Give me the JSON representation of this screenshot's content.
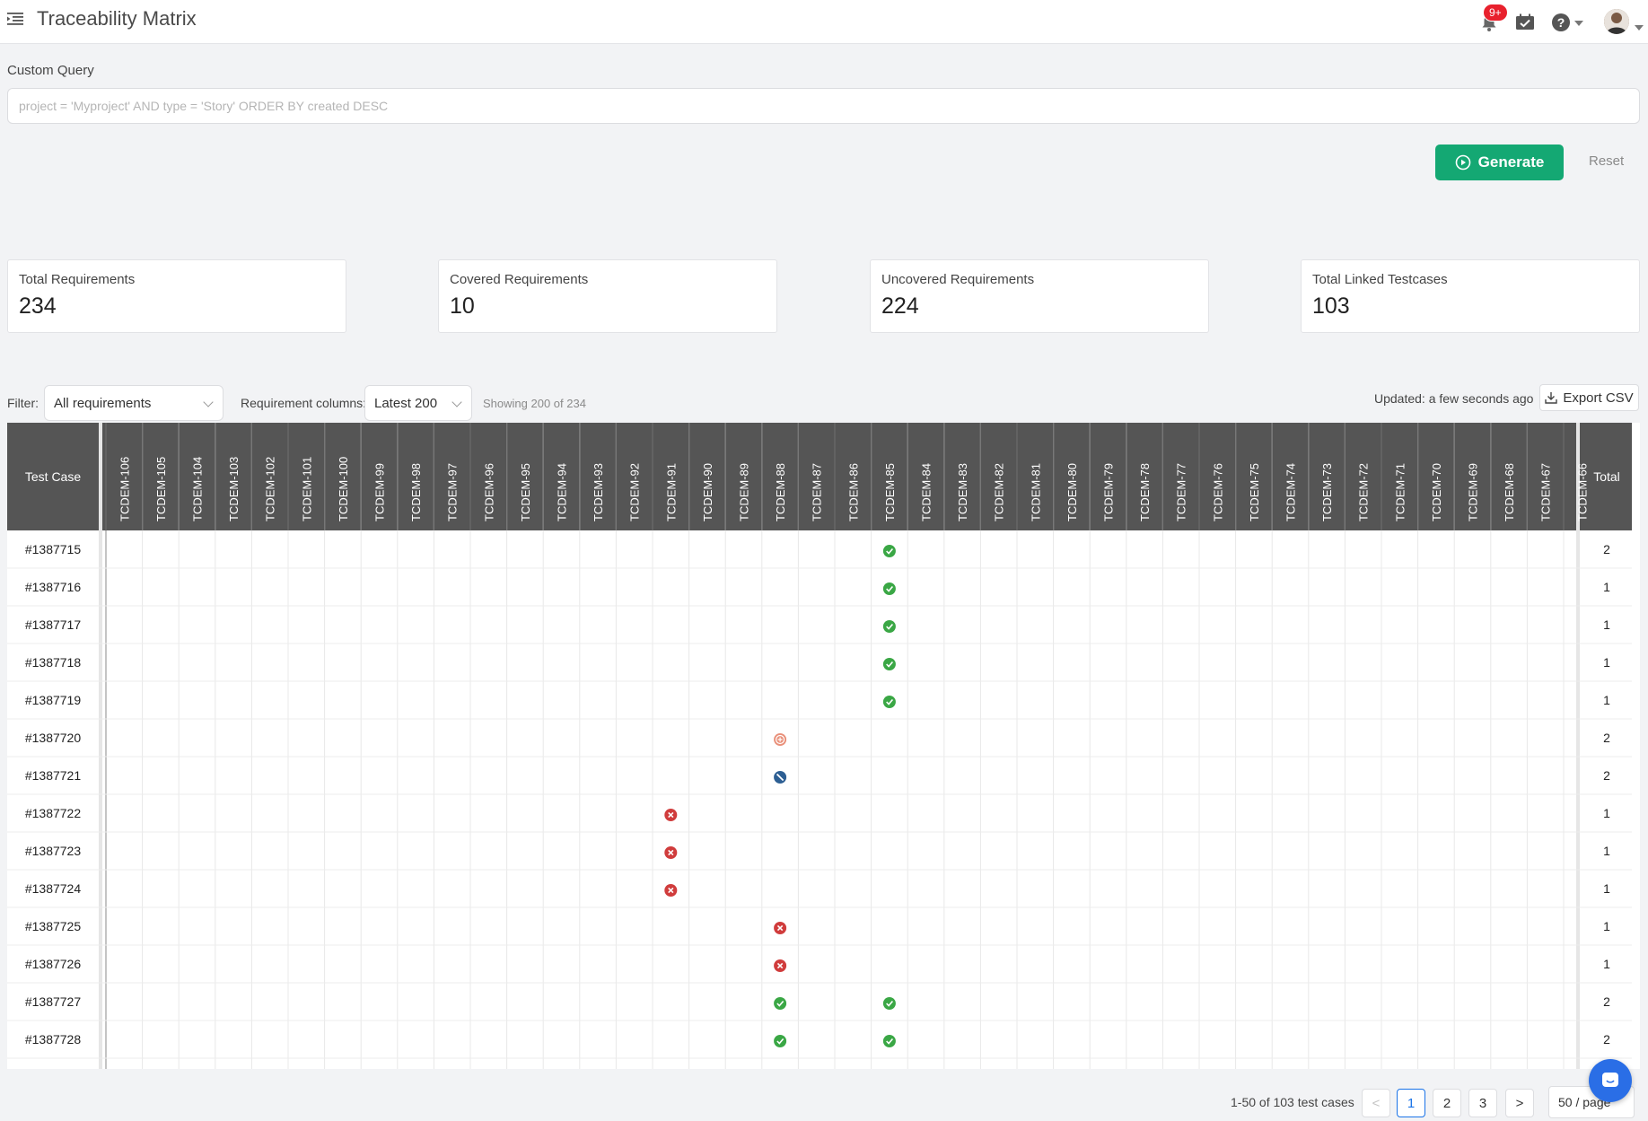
{
  "header": {
    "title": "Traceability Matrix",
    "notification_badge": "9+",
    "icons": [
      "menu-icon",
      "bell-icon",
      "calendar-check-icon",
      "help-icon",
      "avatar"
    ]
  },
  "query": {
    "label": "Custom Query",
    "placeholder": "project = 'Myproject' AND type = 'Story' ORDER BY created DESC",
    "value": ""
  },
  "actions": {
    "generate_label": "Generate",
    "reset_label": "Reset"
  },
  "stats": [
    {
      "label": "Total Requirements",
      "value": "234"
    },
    {
      "label": "Covered Requirements",
      "value": "10"
    },
    {
      "label": "Uncovered Requirements",
      "value": "224"
    },
    {
      "label": "Total Linked Testcases",
      "value": "103"
    }
  ],
  "filters": {
    "filter_label": "Filter:",
    "filter_value": "All requirements",
    "columns_label": "Requirement columns:",
    "columns_value": "Latest 200",
    "showing": "Showing 200 of 234",
    "updated": "Updated: a few seconds ago",
    "export_label": "Export CSV"
  },
  "matrix": {
    "row_header": "Test Case",
    "total_header": "Total",
    "columns": [
      "TCDEM-106",
      "TCDEM-105",
      "TCDEM-104",
      "TCDEM-103",
      "TCDEM-102",
      "TCDEM-101",
      "TCDEM-100",
      "TCDEM-99",
      "TCDEM-98",
      "TCDEM-97",
      "TCDEM-96",
      "TCDEM-95",
      "TCDEM-94",
      "TCDEM-93",
      "TCDEM-92",
      "TCDEM-91",
      "TCDEM-90",
      "TCDEM-89",
      "TCDEM-88",
      "TCDEM-87",
      "TCDEM-86",
      "TCDEM-85",
      "TCDEM-84",
      "TCDEM-83",
      "TCDEM-82",
      "TCDEM-81",
      "TCDEM-80",
      "TCDEM-79",
      "TCDEM-78",
      "TCDEM-77",
      "TCDEM-76",
      "TCDEM-75",
      "TCDEM-74",
      "TCDEM-73",
      "TCDEM-72",
      "TCDEM-71",
      "TCDEM-70",
      "TCDEM-69",
      "TCDEM-68",
      "TCDEM-67",
      "TCDEM-66"
    ],
    "status_colors": {
      "pass": "#3aa745",
      "fail": "#d03c3c",
      "blocked": "#2d5f93",
      "in-progress": "#e9907a"
    },
    "rows": [
      {
        "id": "#1387715",
        "total": "2",
        "marks": [
          {
            "col": "TCDEM-85",
            "status": "pass"
          }
        ]
      },
      {
        "id": "#1387716",
        "total": "1",
        "marks": [
          {
            "col": "TCDEM-85",
            "status": "pass"
          }
        ]
      },
      {
        "id": "#1387717",
        "total": "1",
        "marks": [
          {
            "col": "TCDEM-85",
            "status": "pass"
          }
        ]
      },
      {
        "id": "#1387718",
        "total": "1",
        "marks": [
          {
            "col": "TCDEM-85",
            "status": "pass"
          }
        ]
      },
      {
        "id": "#1387719",
        "total": "1",
        "marks": [
          {
            "col": "TCDEM-85",
            "status": "pass"
          }
        ]
      },
      {
        "id": "#1387720",
        "total": "2",
        "marks": [
          {
            "col": "TCDEM-88",
            "status": "in-progress"
          }
        ]
      },
      {
        "id": "#1387721",
        "total": "2",
        "marks": [
          {
            "col": "TCDEM-88",
            "status": "blocked"
          }
        ]
      },
      {
        "id": "#1387722",
        "total": "1",
        "marks": [
          {
            "col": "TCDEM-91",
            "status": "fail"
          }
        ]
      },
      {
        "id": "#1387723",
        "total": "1",
        "marks": [
          {
            "col": "TCDEM-91",
            "status": "fail"
          }
        ]
      },
      {
        "id": "#1387724",
        "total": "1",
        "marks": [
          {
            "col": "TCDEM-91",
            "status": "fail"
          }
        ]
      },
      {
        "id": "#1387725",
        "total": "1",
        "marks": [
          {
            "col": "TCDEM-88",
            "status": "fail"
          }
        ]
      },
      {
        "id": "#1387726",
        "total": "1",
        "marks": [
          {
            "col": "TCDEM-88",
            "status": "fail"
          }
        ]
      },
      {
        "id": "#1387727",
        "total": "2",
        "marks": [
          {
            "col": "TCDEM-88",
            "status": "pass"
          },
          {
            "col": "TCDEM-85",
            "status": "pass"
          }
        ]
      },
      {
        "id": "#1387728",
        "total": "2",
        "marks": [
          {
            "col": "TCDEM-88",
            "status": "pass"
          },
          {
            "col": "TCDEM-85",
            "status": "pass"
          }
        ]
      }
    ]
  },
  "pagination": {
    "info": "1-50 of 103 test cases",
    "prev": "<",
    "pages": [
      "1",
      "2",
      "3"
    ],
    "current": "1",
    "next": ">",
    "page_size": "50 / page"
  }
}
